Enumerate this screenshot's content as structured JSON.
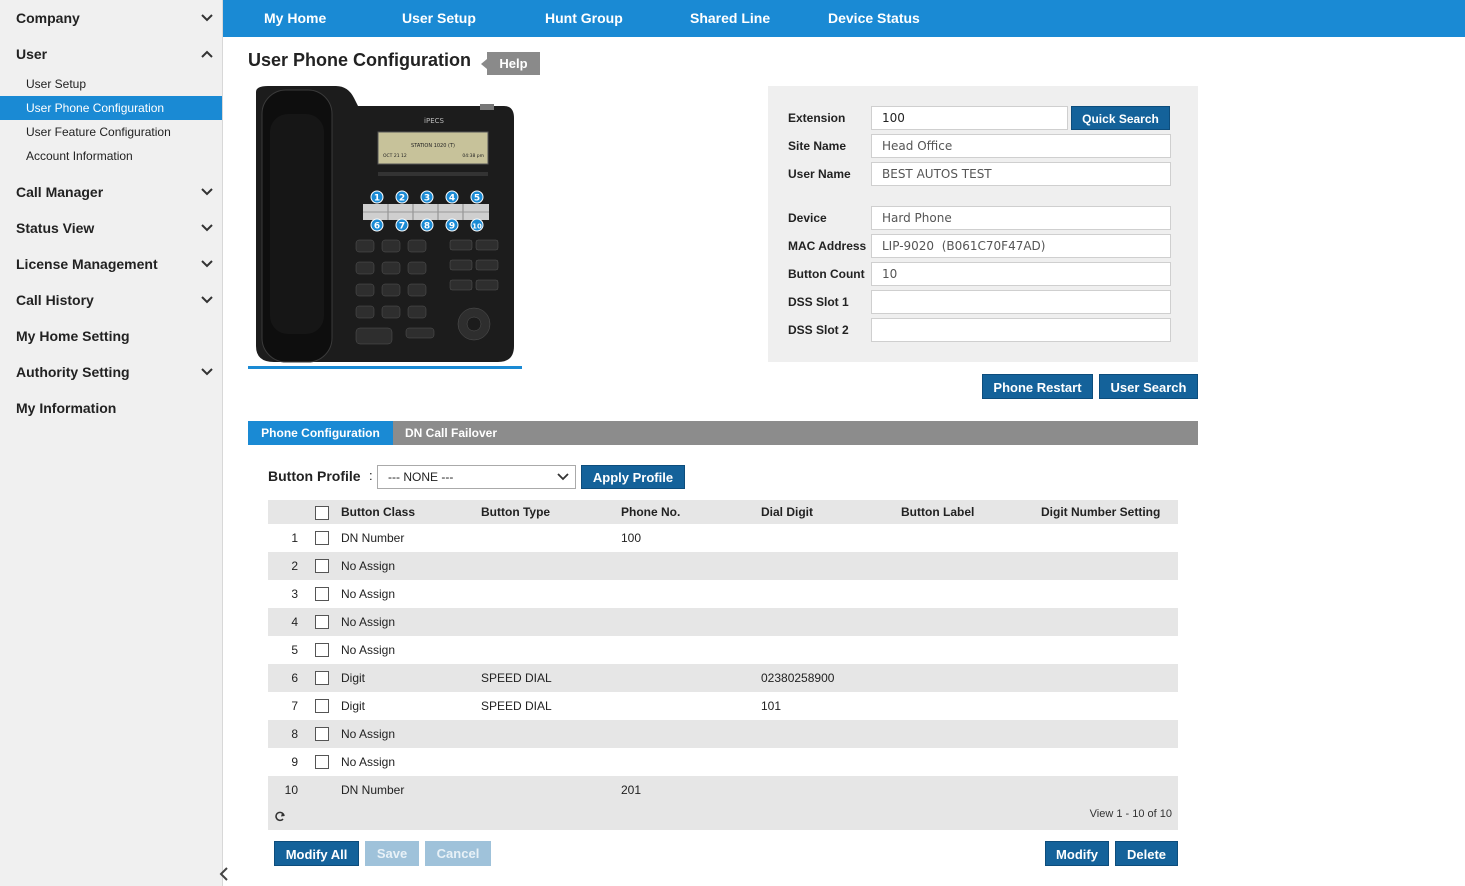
{
  "sidebar": {
    "items": [
      {
        "label": "Company",
        "expanded": false
      },
      {
        "label": "User",
        "expanded": true,
        "children": [
          "User Setup",
          "User Phone Configuration",
          "User Feature Configuration",
          "Account Information"
        ],
        "active_child": "User Phone Configuration"
      },
      {
        "label": "Call Manager",
        "expanded": false
      },
      {
        "label": "Status View",
        "expanded": false
      },
      {
        "label": "License Management",
        "expanded": false
      },
      {
        "label": "Call History",
        "expanded": false
      },
      {
        "label": "My Home Setting"
      },
      {
        "label": "Authority Setting",
        "expanded": false
      },
      {
        "label": "My Information"
      }
    ]
  },
  "topnav": {
    "tabs": [
      "My Home",
      "User Setup",
      "Hunt Group",
      "Shared Line",
      "Device Status"
    ]
  },
  "page": {
    "title": "User Phone Configuration",
    "help_label": "Help"
  },
  "phone_graphic": {
    "brand": "iPECS",
    "screen_line1": "STATION 1020 (T)",
    "screen_line2_left": "OCT 21 12",
    "screen_line2_right": "04:38 pm",
    "button_numbers": [
      "1",
      "2",
      "3",
      "4",
      "5",
      "6",
      "7",
      "8",
      "9",
      "10"
    ]
  },
  "info": {
    "extension_label": "Extension",
    "extension_value": "100",
    "quick_search_label": "Quick Search",
    "site_name_label": "Site Name",
    "site_name_value": "Head Office",
    "user_name_label": "User Name",
    "user_name_value": "BEST AUTOS TEST",
    "device_label": "Device",
    "device_value": "Hard Phone",
    "mac_label": "MAC Address",
    "mac_value": "LIP-9020  (B061C70F47AD)",
    "button_count_label": "Button Count",
    "button_count_value": "10",
    "dss1_label": "DSS Slot 1",
    "dss1_value": "",
    "dss2_label": "DSS Slot 2",
    "dss2_value": ""
  },
  "actions": {
    "phone_restart": "Phone Restart",
    "user_search": "User Search",
    "apply_profile": "Apply Profile",
    "modify_all": "Modify All",
    "save": "Save",
    "cancel": "Cancel",
    "modify": "Modify",
    "delete": "Delete"
  },
  "subtabs": [
    "Phone Configuration",
    "DN Call Failover"
  ],
  "button_profile": {
    "label": "Button Profile",
    "colon": ":",
    "selected": "--- NONE ---"
  },
  "grid": {
    "columns": [
      "Button Class",
      "Button Type",
      "Phone No.",
      "Dial Digit",
      "Button Label",
      "Digit Number Setting"
    ],
    "rows": [
      {
        "num": "1",
        "class": "DN Number",
        "type": "",
        "phone": "100",
        "dial": "",
        "label": "",
        "setting": "",
        "checkbox": true
      },
      {
        "num": "2",
        "class": "No Assign",
        "type": "",
        "phone": "",
        "dial": "",
        "label": "",
        "setting": "",
        "checkbox": true
      },
      {
        "num": "3",
        "class": "No Assign",
        "type": "",
        "phone": "",
        "dial": "",
        "label": "",
        "setting": "",
        "checkbox": true
      },
      {
        "num": "4",
        "class": "No Assign",
        "type": "",
        "phone": "",
        "dial": "",
        "label": "",
        "setting": "",
        "checkbox": true
      },
      {
        "num": "5",
        "class": "No Assign",
        "type": "",
        "phone": "",
        "dial": "",
        "label": "",
        "setting": "",
        "checkbox": true
      },
      {
        "num": "6",
        "class": "Digit",
        "type": "SPEED DIAL",
        "phone": "",
        "dial": "02380258900",
        "label": "",
        "setting": "",
        "checkbox": true
      },
      {
        "num": "7",
        "class": "Digit",
        "type": "SPEED DIAL",
        "phone": "",
        "dial": "101",
        "label": "",
        "setting": "",
        "checkbox": true
      },
      {
        "num": "8",
        "class": "No Assign",
        "type": "",
        "phone": "",
        "dial": "",
        "label": "",
        "setting": "",
        "checkbox": true
      },
      {
        "num": "9",
        "class": "No Assign",
        "type": "",
        "phone": "",
        "dial": "",
        "label": "",
        "setting": "",
        "checkbox": true
      },
      {
        "num": "10",
        "class": "DN Number",
        "type": "",
        "phone": "201",
        "dial": "",
        "label": "",
        "setting": "",
        "checkbox": false
      }
    ],
    "pager": "View 1 - 10 of 10"
  },
  "colors": {
    "accent": "#1a8ad4",
    "button_dark": "#14629a",
    "sidebar_bg": "#f0f0f0",
    "row_alt": "#e6e6e6"
  }
}
